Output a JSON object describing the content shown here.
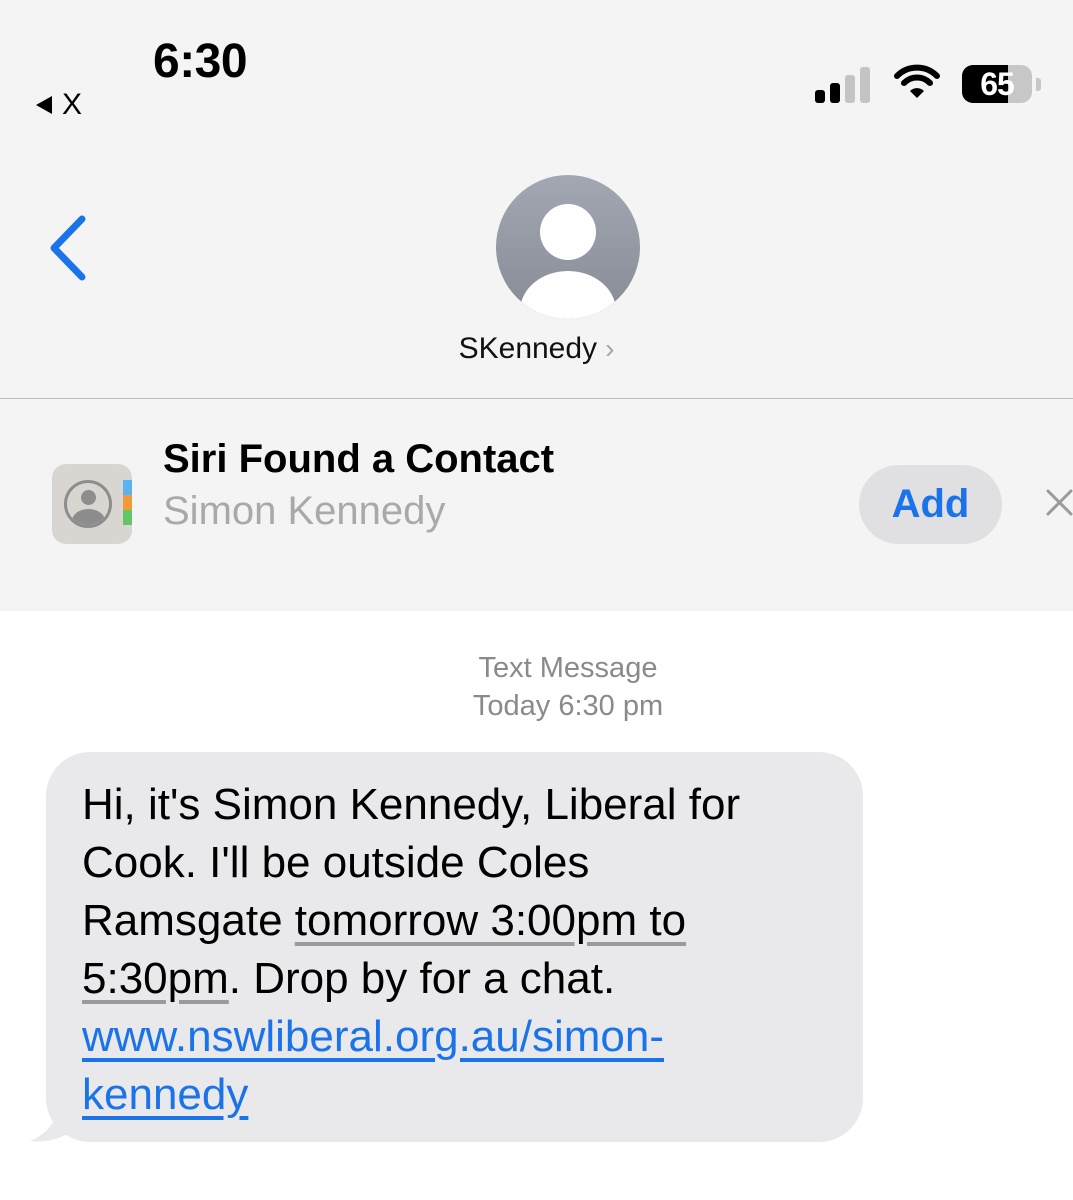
{
  "status_bar": {
    "time": "6:30",
    "back_app_label": "X",
    "battery_level": "65",
    "signal_bars_active": 2,
    "signal_bars_total": 4
  },
  "nav": {
    "contact_name": "SKennedy",
    "chevron": "›",
    "back_icon": "chevron-left-icon",
    "avatar_icon": "person-icon"
  },
  "siri_banner": {
    "title": "Siri Found a Contact",
    "name": "Simon Kennedy",
    "add_label": "Add",
    "app_icon": "contacts-app-icon",
    "dismiss_icon": "close-icon"
  },
  "conversation": {
    "service_label": "Text Message",
    "timestamp": "Today 6:30 pm",
    "message": {
      "line1": "Hi, it's Simon Kennedy, Liberal for",
      "line2": "Cook. I'll be outside Coles",
      "line3_pre": "Ramsgate ",
      "line3_date": "tomorrow 3:00pm to",
      "line4_date": "5:30pm",
      "line4_post": ". Drop by for a chat.",
      "link_line1": "www.nswliberal.org.au/simon-",
      "link_line2": "kennedy"
    }
  },
  "colors": {
    "accent": "#1a73e8",
    "header_bg": "#f4f4f4",
    "bubble_bg": "#e9e9eb",
    "secondary_text": "#8a8a8e"
  }
}
